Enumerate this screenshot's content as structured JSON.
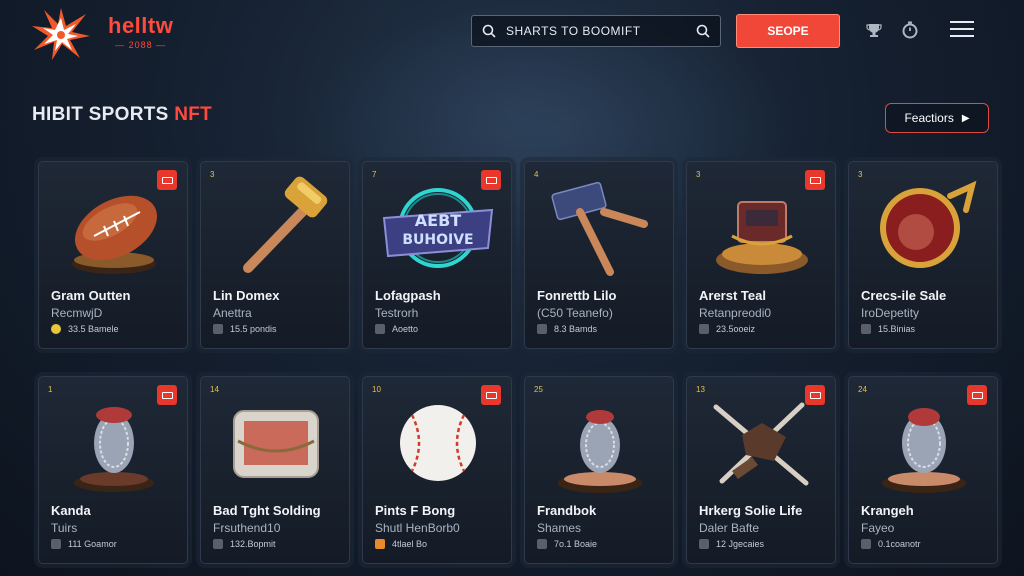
{
  "brand": {
    "name": "helltw",
    "sub": "— 2088 —"
  },
  "search": {
    "placeholder": "SHARTS TO BOOMIFT"
  },
  "header": {
    "cta_label": "SEOPE"
  },
  "section": {
    "title_main": "HIBIT SPORTS ",
    "title_accent": "NFT",
    "featured_label": "Feactiors"
  },
  "icons": {
    "logo": "spiky-star-logo",
    "search": "search-icon",
    "search_end": "search-icon",
    "header_1": "trophy-icon",
    "header_2": "timer-icon",
    "menu": "hamburger-menu-icon",
    "card_badge": "bookmark-icon"
  },
  "colors": {
    "accent": "#f14739",
    "background": "#152030",
    "card": "#1c2430",
    "badge_gold": "#e6c04a"
  },
  "cards": [
    {
      "num": "",
      "badge": true,
      "art": "football",
      "name": "Gram Outten",
      "sub": "RecmwjD",
      "meta": "33.5 Bamele"
    },
    {
      "num": "3",
      "badge": false,
      "art": "hammer",
      "name": "Lin Domex",
      "sub": "Anettra",
      "meta": "15.5 pondis"
    },
    {
      "num": "7",
      "badge": true,
      "art": "neon-sign",
      "name": "Lofagpash",
      "sub": "Testrorh",
      "meta": "Aoetto"
    },
    {
      "num": "4",
      "badge": false,
      "art": "mallet",
      "name": "Fonrettb Lilo",
      "sub": "(C50 Teanefo)",
      "meta": "8.3 Bamds"
    },
    {
      "num": "3",
      "badge": true,
      "art": "trophy-box",
      "name": "Arerst Teal",
      "sub": "Retanpreodi0",
      "meta": "23.5ooeiz"
    },
    {
      "num": "3",
      "badge": false,
      "art": "gem-disc",
      "name": "Crecs-ile Sale",
      "sub": "IroDepetity",
      "meta": "15.Binias"
    },
    {
      "num": "1",
      "badge": true,
      "art": "chain-trophy",
      "name": "Kanda",
      "sub": "Tuirs",
      "meta": "111 Goamor"
    },
    {
      "num": "14",
      "badge": false,
      "art": "chest",
      "name": "Bad Tght Solding",
      "sub": "Frsuthend10",
      "meta": "132.Bopmit"
    },
    {
      "num": "10",
      "badge": true,
      "art": "baseball",
      "name": "Pints F Bong",
      "sub": "Shutl HenBorb0",
      "meta": "4tlael Bo"
    },
    {
      "num": "25",
      "badge": false,
      "art": "chain-trophy",
      "name": "Frandbok",
      "sub": "Shames",
      "meta": "7o.1 Boaie"
    },
    {
      "num": "13",
      "badge": true,
      "art": "crossed-bats",
      "name": "Hrkerg Solie Life",
      "sub": "Daler Bafte",
      "meta": "12 Jgecaies"
    },
    {
      "num": "24",
      "badge": true,
      "art": "chain-trophy",
      "name": "Krangeh",
      "sub": "Fayeo",
      "meta": "0.1coanotr"
    }
  ]
}
